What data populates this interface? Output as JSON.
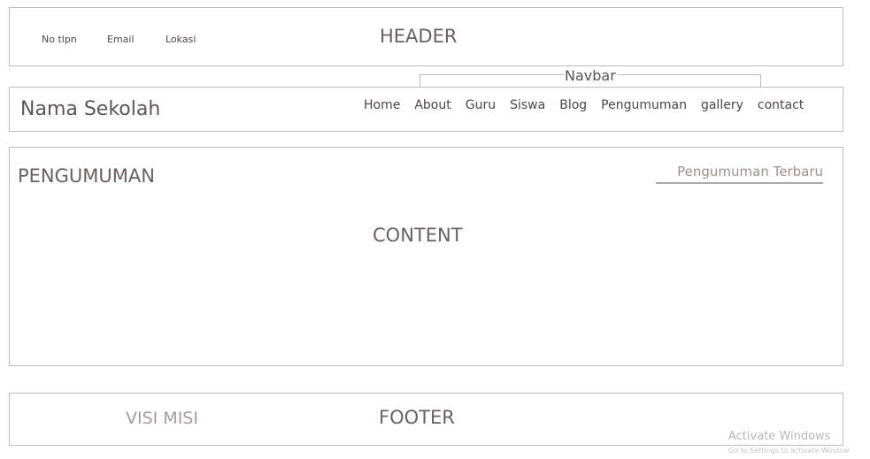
{
  "header": {
    "contacts": {
      "phone": "No tlpn",
      "email": "Email",
      "location": "Lokasi"
    },
    "label": "HEADER"
  },
  "navbar": {
    "annotation": "Navbar",
    "school_name": "Nama Sekolah",
    "items": [
      "Home",
      "About",
      "Guru",
      "Siswa",
      "Blog",
      "Pengumuman",
      "gallery",
      "contact"
    ]
  },
  "content": {
    "section_title": "PENGUMUMAN",
    "latest_link": "Pengumuman Terbaru",
    "label": "CONTENT"
  },
  "footer": {
    "visi_misi": "VISI MISI",
    "label": "FOOTER"
  },
  "watermark": {
    "title": "Activate Windows",
    "subtitle": "Go to Settings to activate Window"
  }
}
